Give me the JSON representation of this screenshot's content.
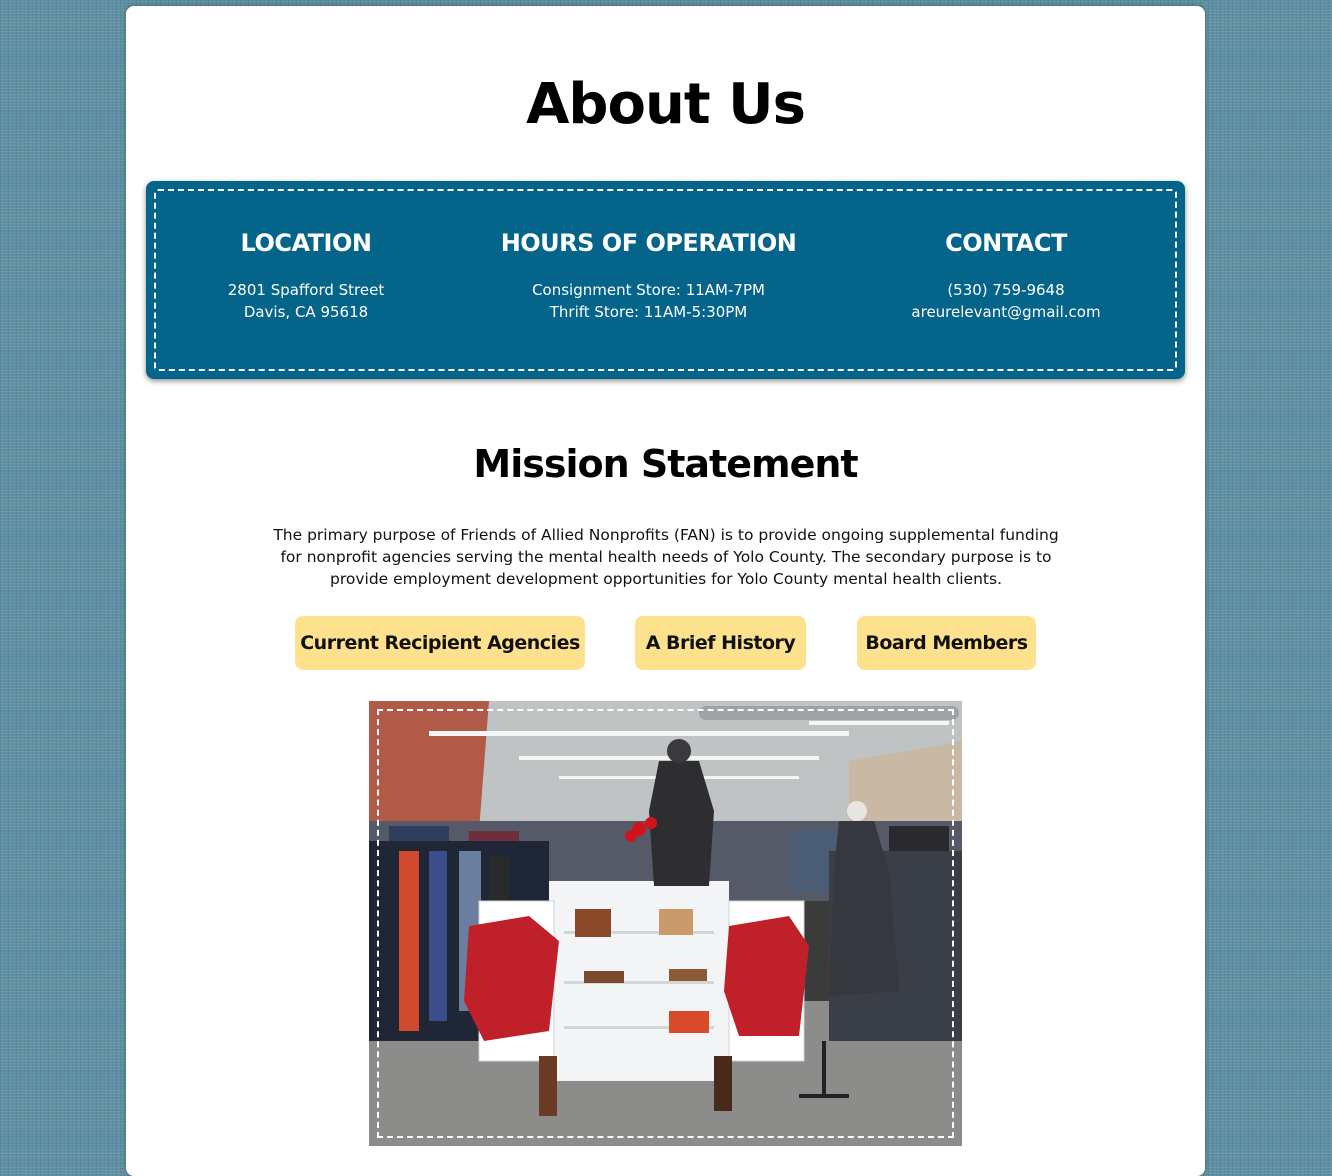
{
  "page": {
    "title": "About Us"
  },
  "info": {
    "location": {
      "heading": "LOCATION",
      "line1": "2801 Spafford Street",
      "line2": "Davis, CA 95618"
    },
    "hours": {
      "heading": "HOURS OF OPERATION",
      "line1": "Consignment Store: 11AM-7PM",
      "line2": "Thrift Store: 11AM-5:30PM"
    },
    "contact": {
      "heading": "CONTACT",
      "phone": "(530) 759-9648",
      "email": "areurelevant@gmail.com"
    }
  },
  "mission": {
    "title": "Mission Statement",
    "text": "The primary purpose of Friends of Allied Nonprofits (FAN) is to provide ongoing supplemental funding for nonprofit agencies serving the mental health needs of Yolo County. The secondary purpose is to provide employment development opportunities for Yolo County mental health clients."
  },
  "buttons": {
    "agencies": "Current Recipient Agencies",
    "history": "A Brief History",
    "board": "Board Members"
  },
  "colors": {
    "panel": "#05648a",
    "button": "#fde18c",
    "background": "#5e8fa3"
  }
}
